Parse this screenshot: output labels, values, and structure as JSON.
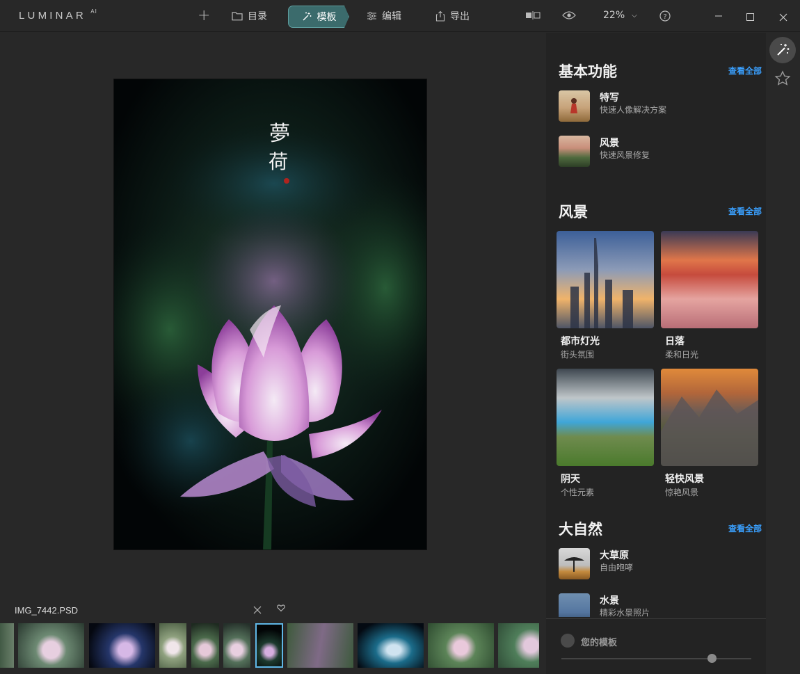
{
  "app": {
    "logo": "LUMINAR",
    "logo_sup": "AI"
  },
  "toolbar": {
    "add_label": "+",
    "tabs": [
      {
        "label": "目录",
        "icon": "folder-icon"
      },
      {
        "label": "模板",
        "icon": "magic-wand-icon",
        "active": true
      },
      {
        "label": "编辑",
        "icon": "sliders-icon"
      },
      {
        "label": "导出",
        "icon": "share-icon"
      }
    ],
    "zoom": "22%",
    "colors": {
      "active_tab": "#3b6b6c",
      "accent_link": "#3aa0ff"
    }
  },
  "photo": {
    "calligraphy": "夢荷"
  },
  "filmstrip": {
    "filename": "IMG_7442.PSD",
    "selected_index": 6
  },
  "panel": {
    "sections": [
      {
        "title": "基本功能",
        "see_all": "查看全部",
        "items": [
          {
            "title": "特写",
            "subtitle": "快速人像解决方案"
          },
          {
            "title": "风景",
            "subtitle": "快速风景修复"
          }
        ]
      },
      {
        "title": "风景",
        "see_all": "查看全部",
        "cards": [
          {
            "title": "都市灯光",
            "subtitle": "街头氛围"
          },
          {
            "title": "日落",
            "subtitle": "柔和日光"
          },
          {
            "title": "阴天",
            "subtitle": "个性元素"
          },
          {
            "title": "轻快风景",
            "subtitle": "惊艳风景"
          }
        ]
      },
      {
        "title": "大自然",
        "see_all": "查看全部",
        "items": [
          {
            "title": "大草原",
            "subtitle": "自由咆哮"
          },
          {
            "title": "水景",
            "subtitle": "精彩水景照片"
          }
        ]
      }
    ],
    "my_templates": "您的模板",
    "thumb_size_level": 0.79
  }
}
